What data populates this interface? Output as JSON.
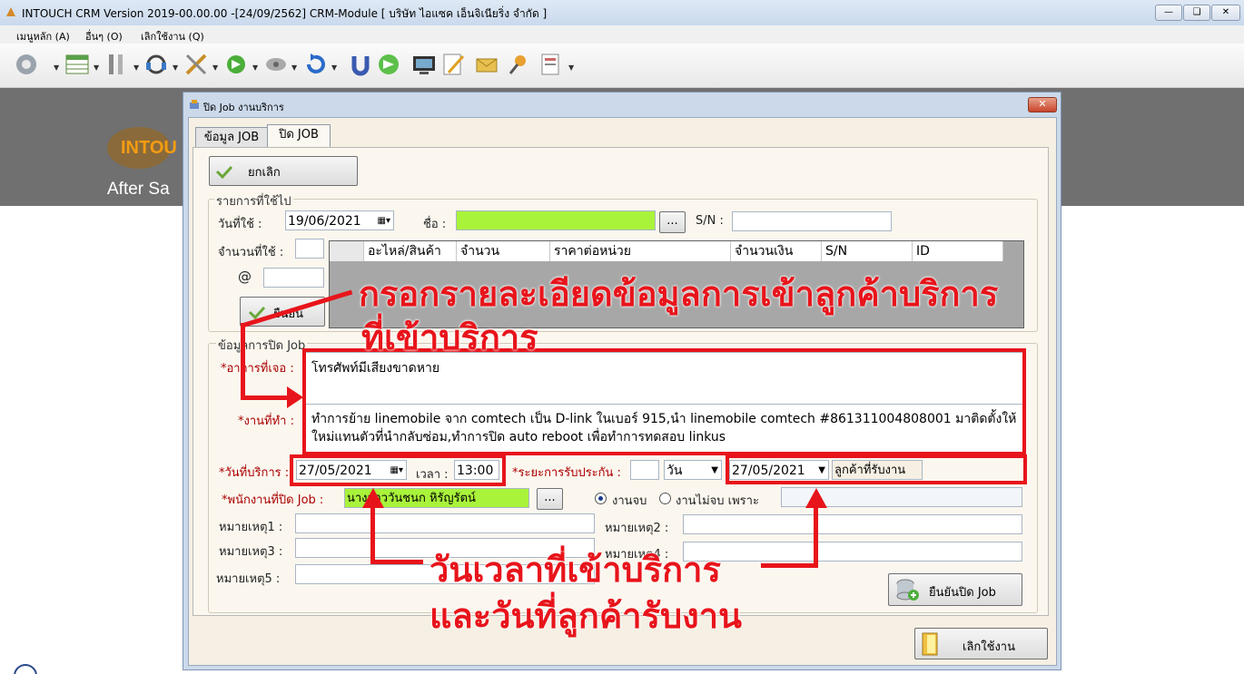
{
  "window": {
    "title": "INTOUCH CRM Version 2019-00.00.00 -[24/09/2562] CRM-Module  [ บริษัท ไอแซค เอ็นจิเนียริ่ง จำกัด ]"
  },
  "menu": [
    "เมนูหลัก (A)",
    "อื่นๆ (O)",
    "เลิกใช้งาน (Q)"
  ],
  "toolbar_icons": [
    "gear-icon",
    "table-icon",
    "tools-icon",
    "headset-icon",
    "wrench-icon",
    "refresh-arrow-icon",
    "satellite-icon",
    "undo-icon",
    "magnet-icon",
    "green-arrow-icon",
    "monitor-icon",
    "edit-icon",
    "envelope-icon",
    "pin-icon",
    "report-icon"
  ],
  "background": {
    "logo_text": "INTOU",
    "subtitle": "After Sa"
  },
  "dialog": {
    "title": "ปิด Job งานบริการ",
    "tabs": [
      "ข้อมูล JOB",
      "ปิด JOB"
    ],
    "cancel_label": "ยกเลิก",
    "used_items": {
      "legend": "รายการที่ใช้ไป",
      "date_label": "วันที่ใช้ :",
      "date_value": "19/06/2021",
      "name_label": "ชื่อ :",
      "name_value": "",
      "browse_label": "...",
      "sn_label": "S/N :",
      "qty_label": "จำนวนที่ใช้ :",
      "at_label": "@",
      "confirm_label": "ยืนยัน",
      "columns": [
        "",
        "อะไหล่/สินค้า",
        "จำนวน",
        "ราคาต่อหน่วย",
        "จำนวนเงิน",
        "S/N",
        "ID"
      ]
    },
    "close_info": {
      "legend": "ข้อมูลการปิด Job",
      "symptom_label": "*อาการที่เจอ :",
      "symptom_value": "โทรศัพท์มีเสียงขาดหาย",
      "work_label": "*งานที่ทำ :",
      "work_line1": "ทำการย้าย linemobile จาก comtech เป็น D-link ในเบอร์ 915,นำ linemobile comtech #861311004808001 มาติดตั้งให้",
      "work_line2": "ใหม่แทนตัวที่นำกลับซ่อม,ทำการปิด auto reboot เพื่อทำการทดสอบ linkus",
      "service_date_label": "*วันที่บริการ :",
      "service_date_value": "27/05/2021",
      "time_label": "เวลา :",
      "time_value": "13:00",
      "warranty_label": "*ระยะการรับประกัน :",
      "warranty_value": "",
      "warranty_unit": "วัน",
      "customer_date_value": "27/05/2021",
      "customer_received_label": "ลูกค้าที่รับงาน",
      "staff_label": "*พนักงานที่ปิด Job :",
      "staff_value": "นางสาววันชนก หิรัญรัตน์",
      "staff_browse": "...",
      "radio_done": "งานจบ",
      "radio_notdone": "งานไม่จบ  เพราะ",
      "note1_label": "หมายเหตุ1 :",
      "note2_label": "หมายเหตุ2 :",
      "note3_label": "หมายเหตุ3 :",
      "note4_label": "หมายเหตุ4 :",
      "note5_label": "หมายเหตุ5 :",
      "confirm_close_label": "ยืนยันปิด Job"
    },
    "exit_label": "เลิกใช้งาน"
  },
  "annotations": {
    "text1_line1": "กรอกรายละเอียดข้อมูลการเข้าลูกค้าบริการ",
    "text1_line2": "ที่เข้าบริการ",
    "text2_line1": "วันเวลาที่เข้าบริการ",
    "text2_line2": "และวันที่ลูกค้ารับงาน"
  },
  "colors": {
    "annotation_red": "#e8141b",
    "field_green": "#a9f33b"
  }
}
